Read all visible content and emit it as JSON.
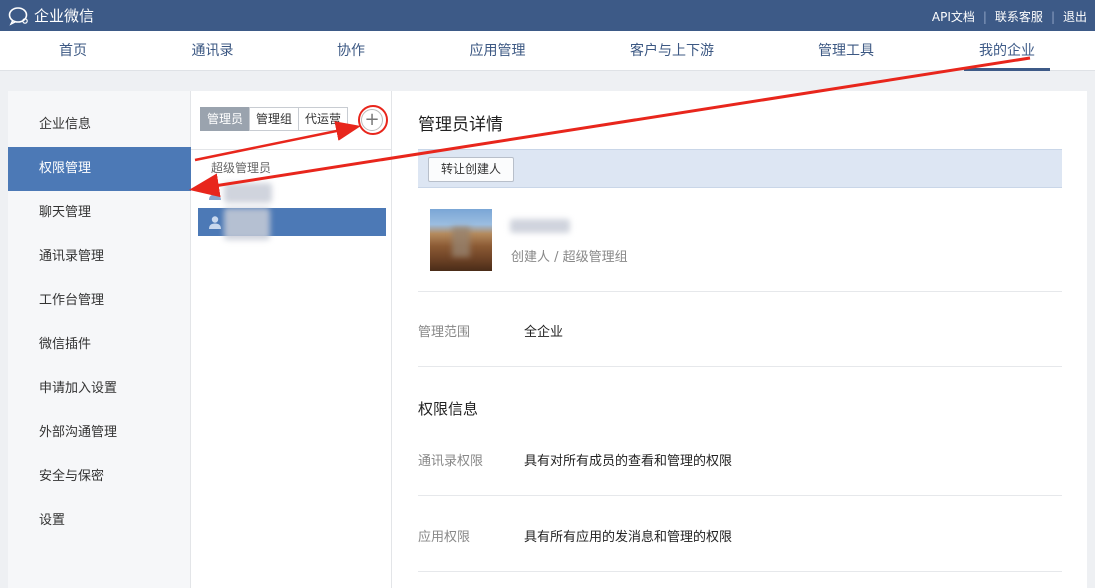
{
  "brand": {
    "name": "企业微信"
  },
  "toplinks": [
    "API文档",
    "联系客服",
    "退出"
  ],
  "nav": {
    "items": [
      "首页",
      "通讯录",
      "协作",
      "应用管理",
      "客户与上下游",
      "管理工具",
      "我的企业"
    ],
    "active_index": 6
  },
  "sidebar": {
    "items": [
      "企业信息",
      "权限管理",
      "聊天管理",
      "通讯录管理",
      "工作台管理",
      "微信插件",
      "申请加入设置",
      "外部沟通管理",
      "安全与保密",
      "设置"
    ],
    "active_index": 1
  },
  "middle": {
    "tabs": [
      "管理员",
      "管理组",
      "代运营"
    ],
    "active_tab": 0,
    "add_label": "+",
    "group_title": "超级管理员"
  },
  "detail": {
    "title": "管理员详情",
    "transfer_button": "转让创建人",
    "role_text": "创建人 / 超级管理组",
    "scope_label": "管理范围",
    "scope_value": "全企业",
    "permissions_title": "权限信息",
    "contacts_perm_label": "通讯录权限",
    "contacts_perm_value": "具有对所有成员的查看和管理的权限",
    "app_perm_label": "应用权限",
    "app_perm_value": "具有所有应用的发消息和管理的权限"
  },
  "colors": {
    "topbar": "#3d5a87",
    "active_blue": "#4c79b6",
    "annotation_red": "#e8261c"
  }
}
